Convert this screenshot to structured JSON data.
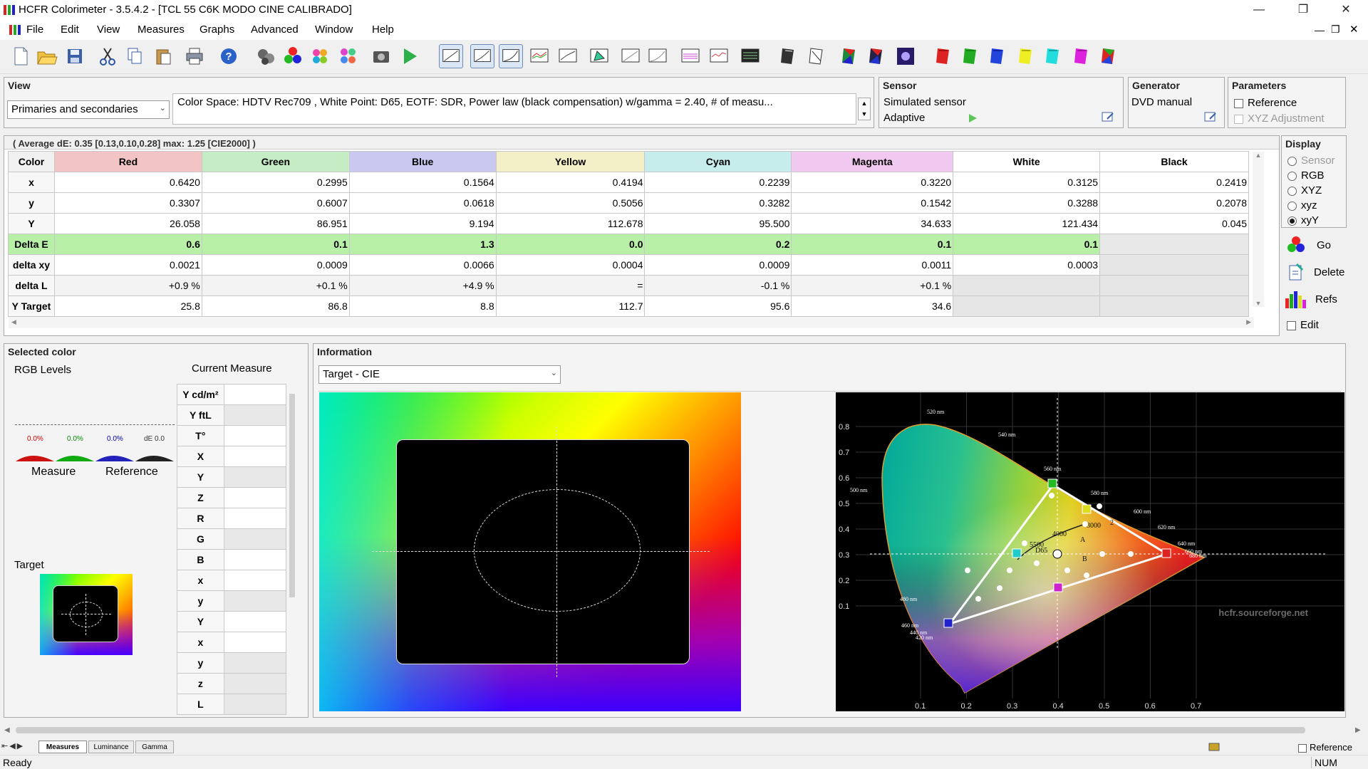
{
  "window": {
    "title": "HCFR Colorimeter - 3.5.4.2 - [TCL 55 C6K MODO CINE CALIBRADO]"
  },
  "menu": [
    "File",
    "Edit",
    "View",
    "Measures",
    "Graphs",
    "Advanced",
    "Window",
    "Help"
  ],
  "view_panel": {
    "title": "View",
    "combo_value": "Primaries and secondaries",
    "info_text": "Color Space: HDTV Rec709 , White Point: D65, EOTF:  SDR, Power law (black compensation) w/gamma = 2.40, # of measu..."
  },
  "sensor_panel": {
    "title": "Sensor",
    "name": "Simulated sensor",
    "mode": "Adaptive"
  },
  "generator_panel": {
    "title": "Generator",
    "name": "DVD manual"
  },
  "parameters_panel": {
    "title": "Parameters",
    "reference": "Reference",
    "xyz_adjustment": "XYZ Adjustment"
  },
  "summary": "( Average dE: 0.35 [0.13,0.10,0.28] max: 1.25 [CIE2000] )",
  "table": {
    "corner": "Color",
    "columns": [
      {
        "label": "Red",
        "color": "#f2c4c4"
      },
      {
        "label": "Green",
        "color": "#c6ecc6"
      },
      {
        "label": "Blue",
        "color": "#c8c8f0"
      },
      {
        "label": "Yellow",
        "color": "#f3f0c8"
      },
      {
        "label": "Cyan",
        "color": "#c6ecec"
      },
      {
        "label": "Magenta",
        "color": "#f1c8ef"
      },
      {
        "label": "White",
        "color": "#ffffff"
      },
      {
        "label": "Black",
        "color": "#ffffff"
      }
    ],
    "rows": [
      {
        "label": "x",
        "values": [
          "0.6420",
          "0.2995",
          "0.1564",
          "0.4194",
          "0.2239",
          "0.3220",
          "0.3125",
          "0.2419"
        ]
      },
      {
        "label": "y",
        "values": [
          "0.3307",
          "0.6007",
          "0.0618",
          "0.5056",
          "0.3282",
          "0.1542",
          "0.3288",
          "0.2078"
        ]
      },
      {
        "label": "Y",
        "values": [
          "26.058",
          "86.951",
          "9.194",
          "112.678",
          "95.500",
          "34.633",
          "121.434",
          "0.045"
        ]
      },
      {
        "label": "Delta E",
        "values": [
          "0.6",
          "0.1",
          "1.3",
          "0.0",
          "0.2",
          "0.1",
          "0.1",
          ""
        ]
      },
      {
        "label": "delta xy",
        "values": [
          "0.0021",
          "0.0009",
          "0.0066",
          "0.0004",
          "0.0009",
          "0.0011",
          "0.0003",
          ""
        ]
      },
      {
        "label": "delta L",
        "values": [
          "+0.9 %",
          "+0.1 %",
          "+4.9 %",
          "=",
          "-0.1 %",
          "+0.1 %",
          "",
          ""
        ]
      },
      {
        "label": "Y Target",
        "values": [
          "25.8",
          "86.8",
          "8.8",
          "112.7",
          "95.6",
          "34.6",
          "",
          ""
        ]
      }
    ]
  },
  "display_panel": {
    "title": "Display",
    "options": [
      {
        "label": "Sensor",
        "checked": false,
        "disabled": true
      },
      {
        "label": "RGB",
        "checked": false,
        "disabled": false
      },
      {
        "label": "XYZ",
        "checked": false,
        "disabled": false
      },
      {
        "label": "xyz",
        "checked": false,
        "disabled": false
      },
      {
        "label": "xyY",
        "checked": true,
        "disabled": false
      }
    ],
    "go": "Go",
    "delete": "Delete",
    "refs": "Refs",
    "edit": "Edit"
  },
  "selected_color": {
    "title": "Selected color",
    "rgb_levels": "RGB Levels",
    "current_measure": "Current Measure",
    "level_labels": [
      "0.0%",
      "0.0%",
      "0.0%",
      "dE 0.0"
    ],
    "measure": "Measure",
    "reference": "Reference",
    "target": "Target",
    "measure_rows": [
      "Y cd/m²",
      "Y ftL",
      "T°",
      "X",
      "Y",
      "Z",
      "R",
      "G",
      "B",
      "x",
      "y",
      "Y",
      "x",
      "y",
      "z",
      "L"
    ]
  },
  "information": {
    "title": "Information",
    "combo_value": "Target - CIE",
    "watermark": "hcfr.sourceforge.net",
    "y_ticks": [
      "0.8",
      "0.7",
      "0.6",
      "0.5",
      "0.4",
      "0.3",
      "0.2",
      "0.1"
    ],
    "x_ticks": [
      "0.1",
      "0.2",
      "0.3",
      "0.4",
      "0.5",
      "0.6",
      "0.7"
    ],
    "wavelengths": [
      "520 nm",
      "540 nm",
      "560 nm",
      "580 nm",
      "600 nm",
      "620 nm",
      "640 nm",
      "660 nm",
      "680 nm",
      "500 nm",
      "480 nm",
      "460 nm",
      "440 nm",
      "420 nm"
    ],
    "cct_labels": [
      "3000",
      "4000",
      "5500",
      "D65",
      "A",
      "B",
      "2"
    ]
  },
  "bottom_tabs": [
    "Measures",
    "Luminance",
    "Gamma"
  ],
  "status": {
    "text": "Ready",
    "reference": "Reference",
    "num": "NUM"
  }
}
